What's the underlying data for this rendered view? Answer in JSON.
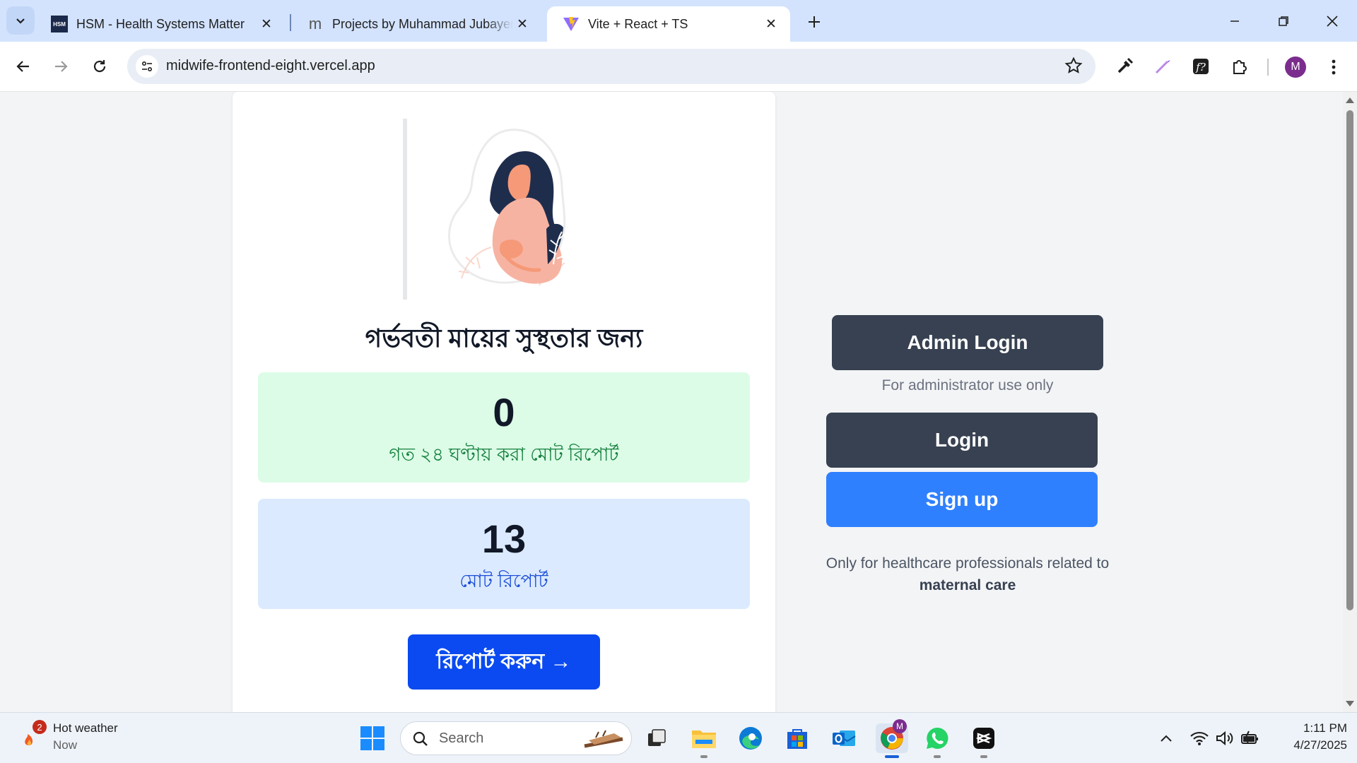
{
  "browser": {
    "tabs": [
      {
        "title": "HSM - Health Systems Matter",
        "favicon": "hsm-logo",
        "favicon_text": "HSM"
      },
      {
        "title": "Projects by Muhammad Jubayer",
        "favicon": "m-logo",
        "favicon_text": "m"
      },
      {
        "title": "Vite + React + TS",
        "favicon": "vite-logo",
        "active": true
      }
    ],
    "url": "midwife-frontend-eight.vercel.app",
    "profile_initial": "M"
  },
  "page": {
    "headline": "গর্ভবতী মায়ের সুস্থতার জন্য",
    "stats": [
      {
        "value": "0",
        "label": "গত ২৪ ঘণ্টায় করা মোট রিপোর্ট",
        "color": "#dcfce7"
      },
      {
        "value": "13",
        "label": "মোট রিপোর্ট",
        "color": "#dbeafe"
      }
    ],
    "report_button": "রিপোর্ট করুন →",
    "admin_login_button": "Admin Login",
    "admin_note": "For administrator use only",
    "login_button": "Login",
    "signup_button": "Sign up",
    "professional_note_prefix": "Only for healthcare professionals related to",
    "professional_note_bold": "maternal care",
    "illustration": "pregnant-woman-illustration"
  },
  "colors": {
    "primary_dark": "#374151",
    "signup_blue": "#2f80fe",
    "report_blue": "#0a4af0",
    "stat_green": "#dcfce7",
    "stat_blue": "#dbeafe"
  },
  "taskbar": {
    "weather_title": "Hot weather",
    "weather_sub": "Now",
    "weather_badge": "2",
    "search_placeholder": "Search",
    "chrome_badge": "M",
    "time": "1:11 PM",
    "date": "4/27/2025"
  }
}
